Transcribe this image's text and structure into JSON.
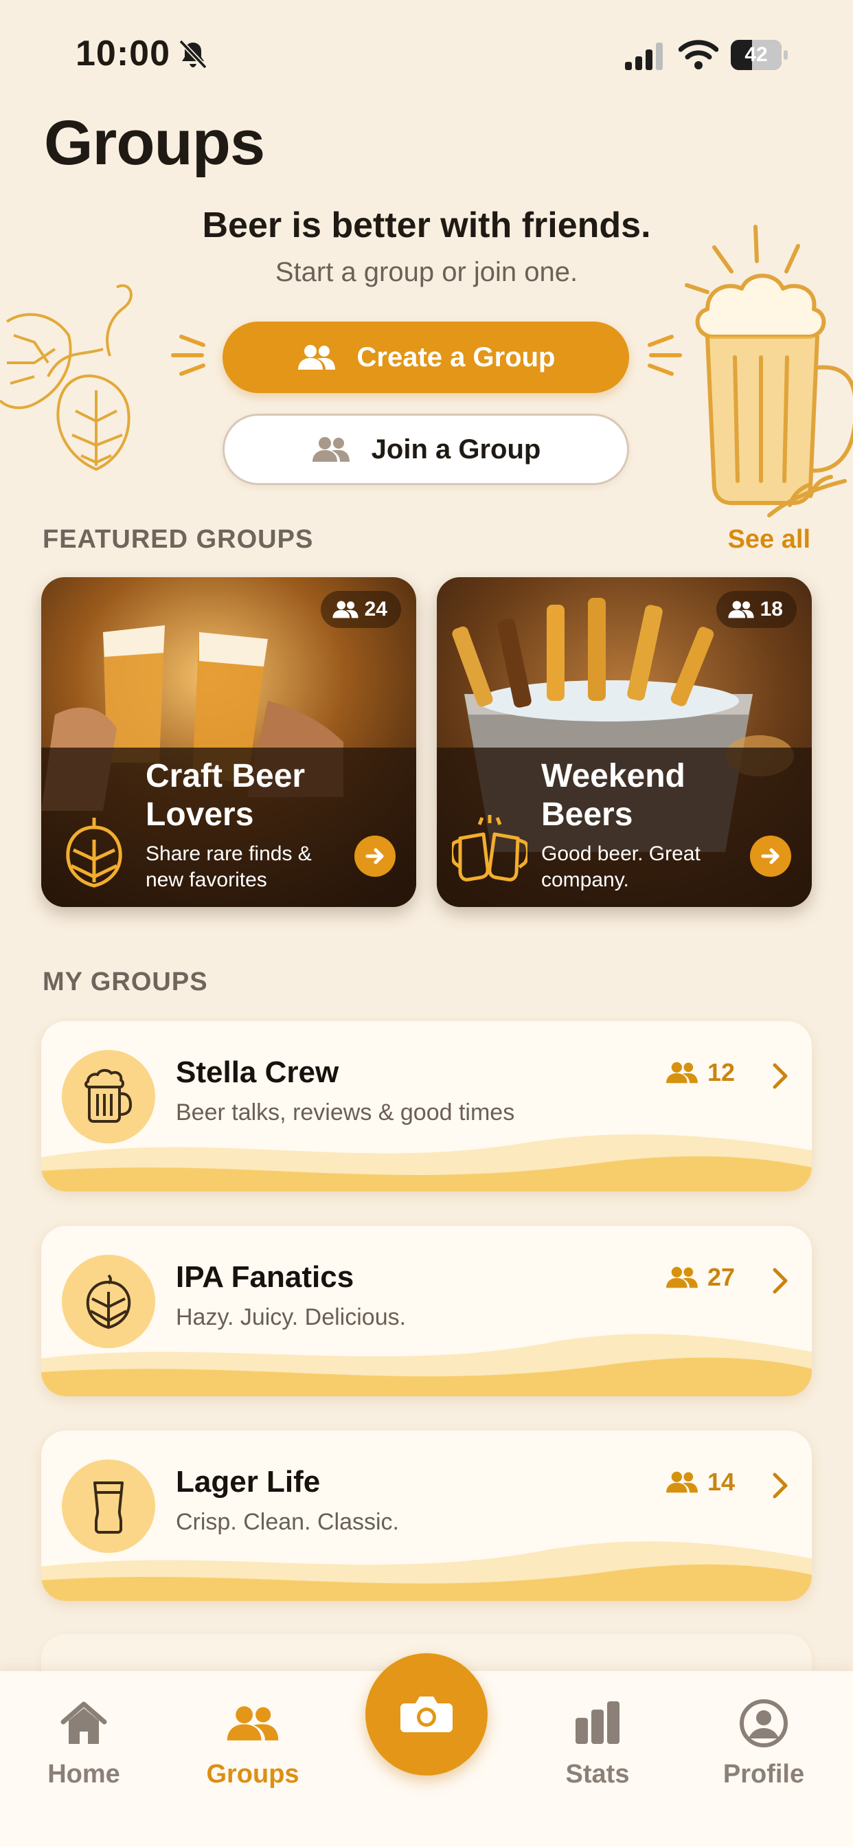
{
  "status_bar": {
    "time": "10:00",
    "battery_level": "42",
    "battery_fraction": 0.42
  },
  "header": {
    "title": "Groups",
    "tagline": "Beer is better with friends.",
    "subtagline": "Start a group or join one."
  },
  "actions": {
    "create_label": "Create a Group",
    "join_label": "Join a Group"
  },
  "featured": {
    "section_label": "FEATURED GROUPS",
    "see_all_label": "See all",
    "cards": [
      {
        "title": "Craft Beer Lovers",
        "subtitle": "Share rare finds & new favorites",
        "members": "24"
      },
      {
        "title": "Weekend Beers",
        "subtitle": "Good beer. Great company.",
        "members": "18"
      }
    ]
  },
  "my_groups": {
    "section_label": "MY GROUPS",
    "items": [
      {
        "name": "Stella Crew",
        "description": "Beer talks, reviews & good times",
        "members": "12",
        "icon": "beer-mug-icon"
      },
      {
        "name": "IPA Fanatics",
        "description": "Hazy. Juicy. Delicious.",
        "members": "27",
        "icon": "hop-icon"
      },
      {
        "name": "Lager Life",
        "description": "Crisp. Clean. Classic.",
        "members": "14",
        "icon": "pint-glass-icon"
      }
    ]
  },
  "tabbar": {
    "home": "Home",
    "groups": "Groups",
    "stats": "Stats",
    "profile": "Profile",
    "active": "groups"
  },
  "colors": {
    "accent": "#e39617",
    "background": "#f9efe0",
    "card": "#fffaf2",
    "icon_circle": "#fbd688",
    "text_dark": "#1f1a14",
    "text_muted": "#6e655c"
  }
}
